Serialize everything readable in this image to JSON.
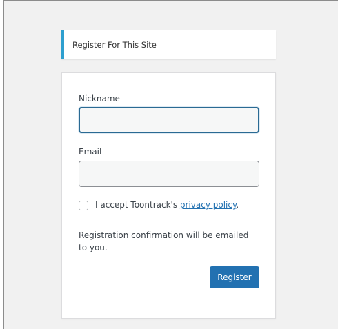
{
  "message": {
    "text": "Register For This Site"
  },
  "form": {
    "nickname_label": "Nickname",
    "nickname_value": "",
    "email_label": "Email",
    "email_value": "",
    "accept_prefix": "I accept Toontrack's ",
    "privacy_link": "privacy policy",
    "accept_suffix": ".",
    "note": "Registration confirmation will be emailed to you.",
    "register_label": "Register"
  },
  "colors": {
    "accent": "#2e9fcf",
    "button": "#2271b1",
    "link": "#2271b1",
    "background": "#f1f1f1"
  }
}
